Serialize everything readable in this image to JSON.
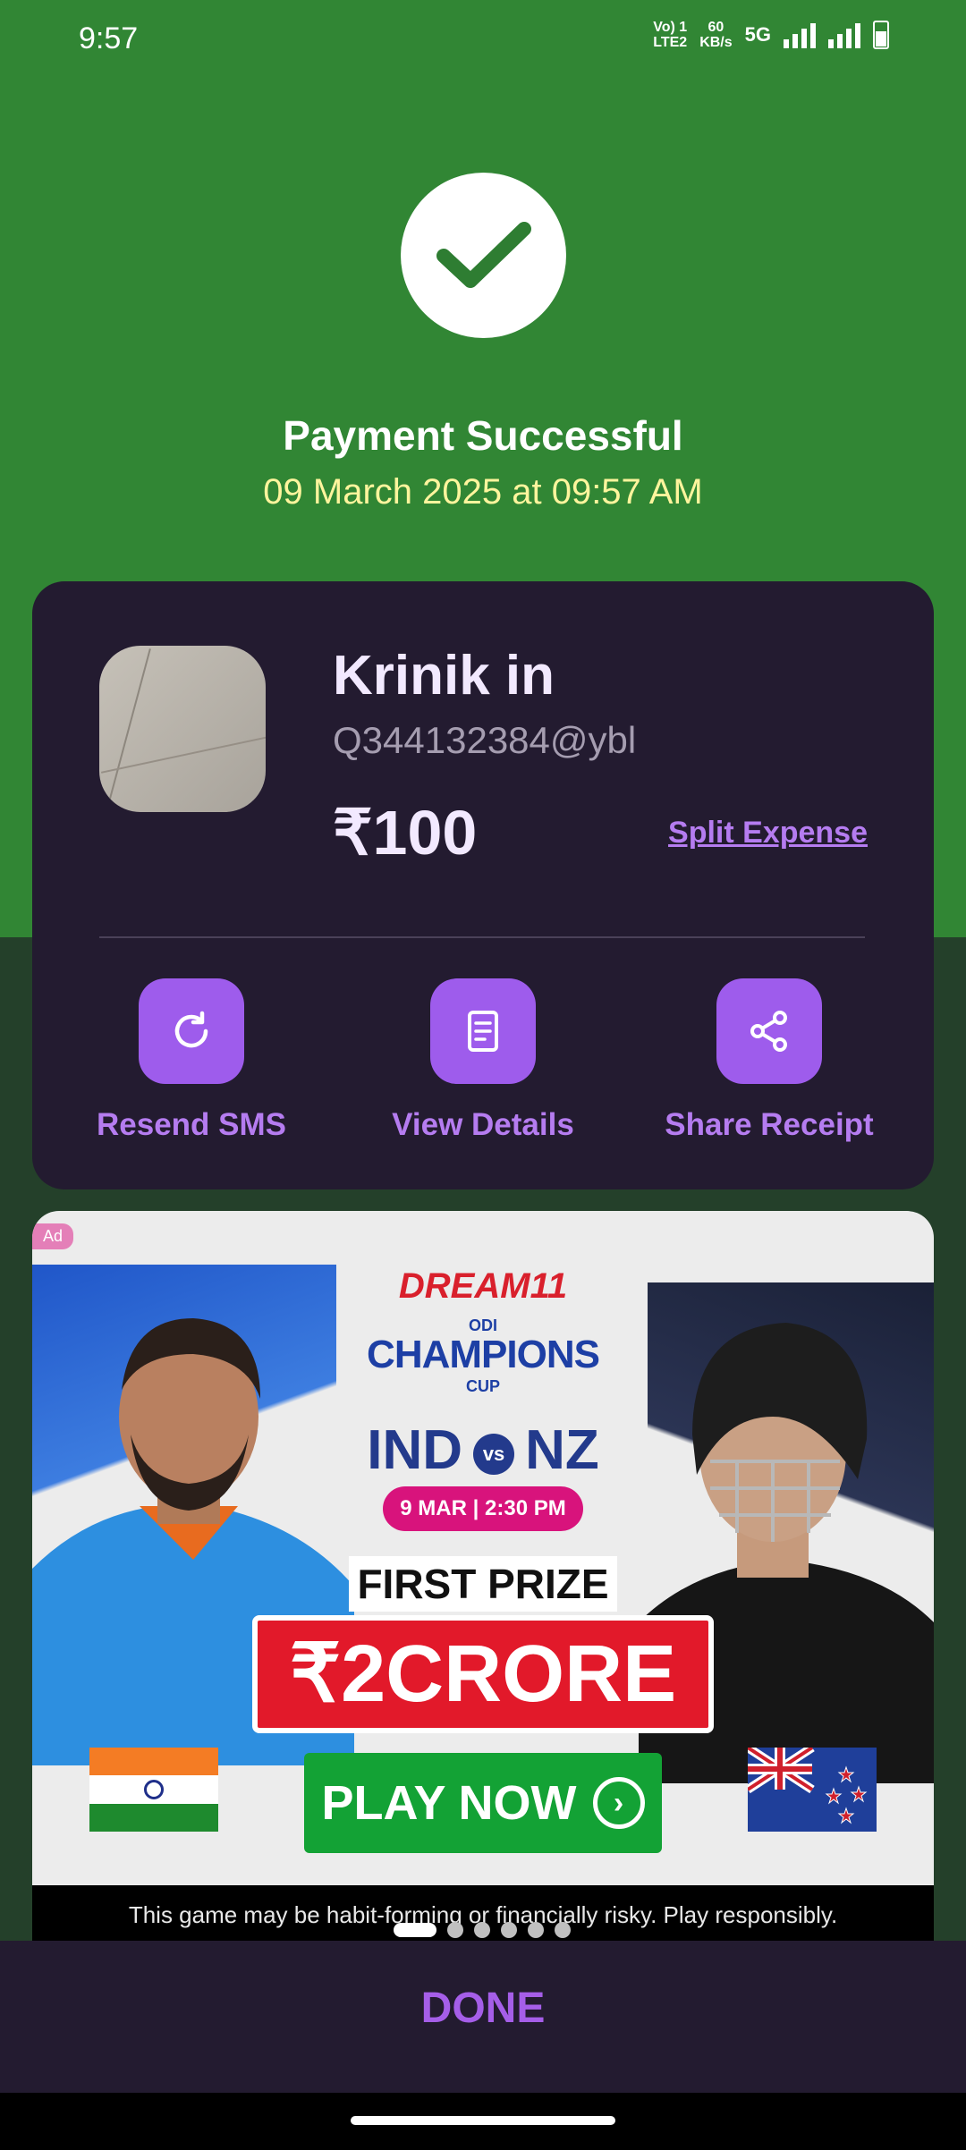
{
  "status_bar": {
    "time": "9:57",
    "volte": "Vo) 1\nLTE2",
    "speed_value": "60",
    "speed_unit": "KB/s",
    "network": "5G"
  },
  "header": {
    "title": "Payment Successful",
    "datetime": "09 March 2025 at 09:57 AM"
  },
  "payment": {
    "payee_name": "Krinik in",
    "upi_id": "Q344132384@ybl",
    "amount": "₹100",
    "split_label": "Split Expense"
  },
  "actions": [
    {
      "label": "Resend SMS",
      "icon": "refresh-icon"
    },
    {
      "label": "View Details",
      "icon": "document-icon"
    },
    {
      "label": "Share Receipt",
      "icon": "share-icon"
    }
  ],
  "ad": {
    "badge": "Ad",
    "brand": "DREAM11",
    "cup_top": "ODI",
    "cup_name": "CHAMPIONS",
    "cup_bottom": "CUP",
    "team_a": "IND",
    "vs": "vs",
    "team_b": "NZ",
    "match_date": "9 MAR | 2:30 PM",
    "first_prize": "FIRST PRIZE",
    "prize_amount": "₹2CRORE",
    "cta": "PLAY NOW",
    "disclaimer": "This game may be habit-forming or financially risky. Play responsibly.",
    "carousel_count": 6,
    "carousel_active": 1
  },
  "footer": {
    "done_label": "DONE"
  },
  "colors": {
    "success_green": "#318634",
    "card_bg": "#231b30",
    "accent_purple": "#9e5cec",
    "date_yellow": "#fff59d"
  }
}
